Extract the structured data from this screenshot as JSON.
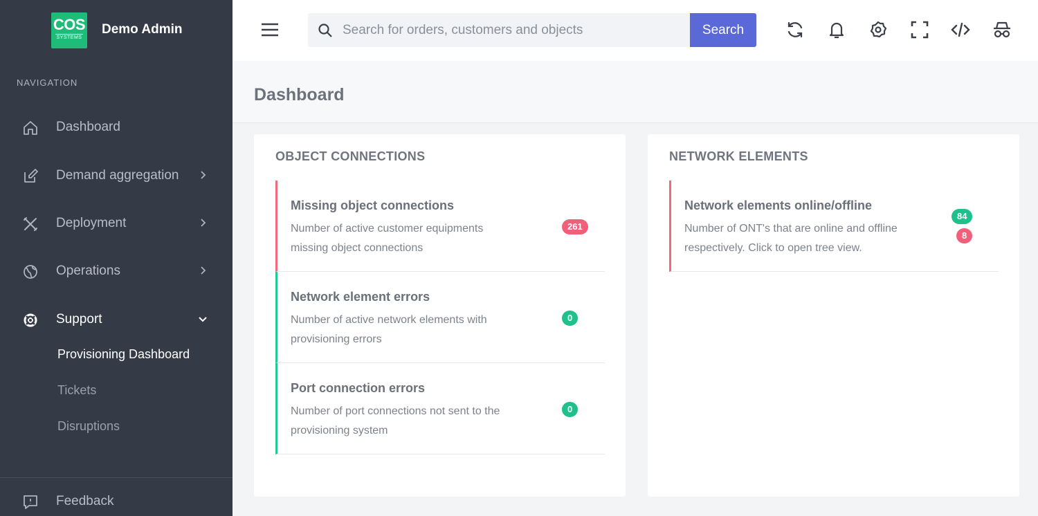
{
  "brand": {
    "logo_line1": "COS",
    "logo_line2": "SYSTEMS",
    "name": "Demo Admin"
  },
  "sidebar": {
    "heading": "NAVIGATION",
    "items": [
      {
        "label": "Dashboard",
        "icon": "home-icon"
      },
      {
        "label": "Demand aggregation",
        "icon": "edit-icon"
      },
      {
        "label": "Deployment",
        "icon": "tools-icon"
      },
      {
        "label": "Operations",
        "icon": "globe-icon"
      },
      {
        "label": "Support",
        "icon": "lifebuoy-icon"
      }
    ],
    "support_sub": [
      "Provisioning Dashboard",
      "Tickets",
      "Disruptions"
    ],
    "feedback": "Feedback"
  },
  "search": {
    "placeholder": "Search for orders, customers and objects",
    "button": "Search"
  },
  "page": {
    "title": "Dashboard"
  },
  "object_connections": {
    "title": "OBJECT CONNECTIONS",
    "items": [
      {
        "title": "Missing object connections",
        "desc": "Number of active customer equipments missing object connections",
        "badge": "261"
      },
      {
        "title": "Network element errors",
        "desc": "Number of active network elements with provisioning errors",
        "badge": "0"
      },
      {
        "title": "Port connection errors",
        "desc": "Number of port connections not sent to the provisioning system",
        "badge": "0"
      }
    ]
  },
  "network_elements": {
    "title": "NETWORK ELEMENTS",
    "items": [
      {
        "title": "Network elements online/offline",
        "desc": "Number of ONT's that are online and offline respectively. Click to open tree view.",
        "online": "84",
        "offline": "8"
      }
    ]
  },
  "colors": {
    "sidebar": "#343a46",
    "accent": "#5a68d8",
    "success": "#1fc08c",
    "danger": "#f0607a",
    "brand": "#1fbc79"
  }
}
